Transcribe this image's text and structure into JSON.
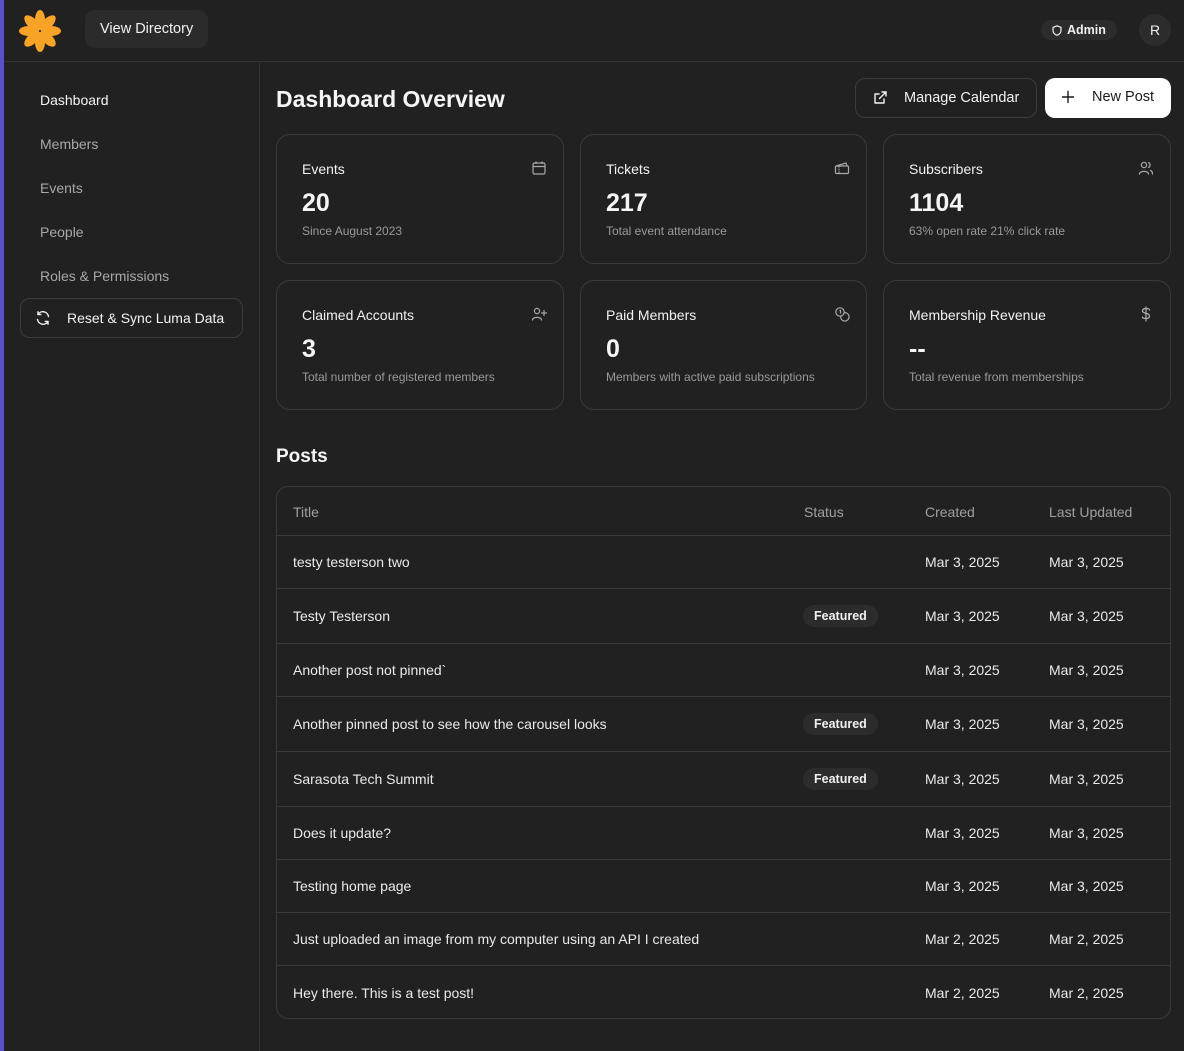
{
  "header": {
    "view_directory_label": "View Directory",
    "admin_label": "Admin",
    "avatar_initial": "R"
  },
  "sidebar": {
    "items": [
      {
        "label": "Dashboard",
        "active": true
      },
      {
        "label": "Members",
        "active": false
      },
      {
        "label": "Events",
        "active": false
      },
      {
        "label": "People",
        "active": false
      },
      {
        "label": "Roles & Permissions",
        "active": false
      }
    ],
    "sync_label": "Reset & Sync Luma Data"
  },
  "main": {
    "title": "Dashboard Overview",
    "manage_calendar_label": "Manage Calendar",
    "new_post_label": "New Post"
  },
  "cards": [
    {
      "title": "Events",
      "value": "20",
      "subtitle": "Since August 2023",
      "icon": "calendar-icon"
    },
    {
      "title": "Tickets",
      "value": "217",
      "subtitle": "Total event attendance",
      "icon": "ticket-icon"
    },
    {
      "title": "Subscribers",
      "value": "1104",
      "subtitle": "63% open rate 21% click rate",
      "icon": "users-icon"
    },
    {
      "title": "Claimed Accounts",
      "value": "3",
      "subtitle": "Total number of registered members",
      "icon": "user-plus-icon"
    },
    {
      "title": "Paid Members",
      "value": "0",
      "subtitle": "Members with active paid subscriptions",
      "icon": "coins-icon"
    },
    {
      "title": "Membership Revenue",
      "value": "--",
      "subtitle": "Total revenue from memberships",
      "icon": "dollar-icon"
    }
  ],
  "posts": {
    "title": "Posts",
    "columns": [
      "Title",
      "Status",
      "Created",
      "Last Updated"
    ],
    "rows": [
      {
        "title": "testy testerson two",
        "status": "",
        "created": "Mar 3, 2025",
        "updated": "Mar 3, 2025"
      },
      {
        "title": "Testy Testerson",
        "status": "Featured",
        "created": "Mar 3, 2025",
        "updated": "Mar 3, 2025"
      },
      {
        "title": "Another post not pinned`",
        "status": "",
        "created": "Mar 3, 2025",
        "updated": "Mar 3, 2025"
      },
      {
        "title": "Another pinned post to see how the carousel looks",
        "status": "Featured",
        "created": "Mar 3, 2025",
        "updated": "Mar 3, 2025"
      },
      {
        "title": "Sarasota Tech Summit",
        "status": "Featured",
        "created": "Mar 3, 2025",
        "updated": "Mar 3, 2025"
      },
      {
        "title": "Does it update?",
        "status": "",
        "created": "Mar 3, 2025",
        "updated": "Mar 3, 2025"
      },
      {
        "title": "Testing home page",
        "status": "",
        "created": "Mar 3, 2025",
        "updated": "Mar 3, 2025"
      },
      {
        "title": "Just uploaded an image from my computer using an API I created",
        "status": "",
        "created": "Mar 2, 2025",
        "updated": "Mar 2, 2025"
      },
      {
        "title": "Hey there. This is a test post!",
        "status": "",
        "created": "Mar 2, 2025",
        "updated": "Mar 2, 2025"
      }
    ]
  },
  "colors": {
    "background": "#212121",
    "accent_bar": "#5b4fcf",
    "logo": "#f7a325"
  }
}
